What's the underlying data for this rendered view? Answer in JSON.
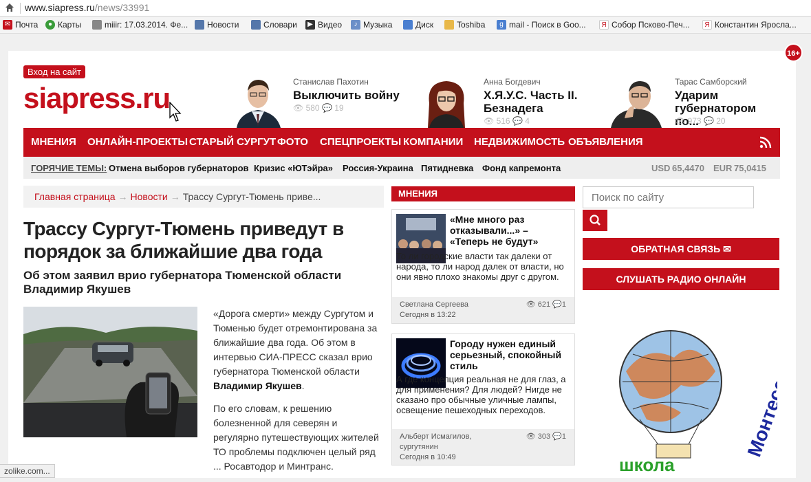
{
  "browser": {
    "url_host": "www.siapress.ru",
    "url_path": "/news/33991",
    "bookmarks": [
      {
        "label": "Почта",
        "icon": "mail-icon",
        "color": "#c4101c"
      },
      {
        "label": "Карты",
        "icon": "maps-icon",
        "color": "#3a9c3a"
      },
      {
        "label": "miiir: 17.03.2014. Фе...",
        "icon": "avatar-icon",
        "color": "#777"
      },
      {
        "label": "Новости",
        "icon": "page-icon",
        "color": "#5577aa"
      },
      {
        "label": "Словари",
        "icon": "page-icon",
        "color": "#5577aa"
      },
      {
        "label": "Видео",
        "icon": "video-icon",
        "color": "#333"
      },
      {
        "label": "Музыка",
        "icon": "music-icon",
        "color": "#6b8fc8"
      },
      {
        "label": "Диск",
        "icon": "disk-icon",
        "color": "#4a7fd0"
      },
      {
        "label": "Toshiba",
        "icon": "folder-icon",
        "color": "#e8b84a"
      },
      {
        "label": "mail - Поиск в Goo...",
        "icon": "google-icon",
        "color": "#4a7fd0"
      },
      {
        "label": "Собор Псково-Печ...",
        "icon": "yandex-icon",
        "color": "#c4101c"
      },
      {
        "label": "Константин Яросла...",
        "icon": "yandex-icon",
        "color": "#c4101c"
      }
    ],
    "status_text": "zolike.com..."
  },
  "site": {
    "age_badge": "16+",
    "login": "Вход на сайт",
    "logo": "siapress.ru"
  },
  "authors": [
    {
      "name": "Станислав Пахотин",
      "title": "Выключить войну",
      "views": "580",
      "comments": "19"
    },
    {
      "name": "Анна Богдевич",
      "title": "Х.Я.У.С. Часть II. Безнадега",
      "views": "516",
      "comments": "4"
    },
    {
      "name": "Тарас Самборский",
      "title": "Ударим губернатором по...",
      "views": "973",
      "comments": "20"
    }
  ],
  "nav": [
    "МНЕНИЯ",
    "ОНЛАЙН-ПРОЕКТЫ",
    "СТАРЫЙ СУРГУТ",
    "ФОТО",
    "СПЕЦПРОЕКТЫ",
    "КОМПАНИИ",
    "НЕДВИЖИМОСТЬ",
    "ОБЪЯВЛЕНИЯ"
  ],
  "hot": {
    "label": "ГОРЯЧИЕ ТЕМЫ:",
    "topics": [
      "Отмена выборов губернаторов",
      "Кризис «ЮТэйра»",
      "Россия-Украина",
      "Пятидневка",
      "Фонд капремонта"
    ],
    "usd_label": "USD",
    "usd": "65,4470",
    "eur_label": "EUR",
    "eur": "75,0415"
  },
  "breadcrumb": {
    "home": "Главная страница",
    "news": "Новости",
    "current": "Трассу Сургут-Тюмень приве...",
    "sep": "→"
  },
  "article": {
    "title": "Трассу Сургут-Тюмень приведут в порядок за ближайшие два года",
    "subtitle": "Об этом заявил врио губернатора Тюменской области Владимир Якушев",
    "p1_a": "«Дорога смерти» между Сургутом и Тюменью будет отремонтирована за ближайшие два года. Об этом в интервью СИА-ПРЕСС сказал врио губернатора Тюменской области",
    "p1_name": "Владимир Якушев",
    "p1_end": ".",
    "p2": "По его словам, к решению болезненной для северян и регулярно путешествующих жителей ТО проблемы подключен целый ряд ... Росавтодор и Минтранс."
  },
  "opinions": {
    "heading": "МНЕНИЯ",
    "cards": [
      {
        "title": "«Мне много раз отказывали...» – «Теперь не будут»",
        "text": "То ли городские власти так далеки от народа, то ли народ далек от власти, но они явно плохо знакомы друг с другом.",
        "author": "Светлана Сергеева",
        "author2": "",
        "date": "Сегодня в 13:22",
        "views": "621",
        "comments": "1"
      },
      {
        "title": "Городу нужен единый серьезный, спокойный стиль",
        "text": "А где концепция реальная не для глаз, а для применения? Для людей? Нигде не сказано про обычные уличные лампы, освещение пешеходных переходов.",
        "author": "Альберт Исмагилов,",
        "author2": "сургутянин",
        "date": "Сегодня в 10:49",
        "views": "303",
        "comments": "1"
      }
    ]
  },
  "sidebar": {
    "search_placeholder": "Поиск по сайту",
    "feedback": "ОБРАТНАЯ СВЯЗЬ",
    "radio": "СЛУШАТЬ РАДИО ОНЛАЙН",
    "banner_text": "Монтессори",
    "banner_text2": "школа"
  },
  "colors": {
    "brand": "#c4101c"
  }
}
